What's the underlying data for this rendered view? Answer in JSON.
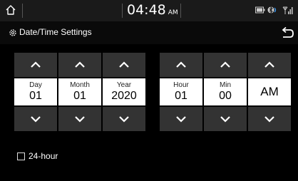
{
  "statusbar": {
    "time": "04:48",
    "ampm": "AM"
  },
  "header": {
    "title": "Date/Time Settings"
  },
  "date": {
    "day": {
      "label": "Day",
      "value": "01"
    },
    "month": {
      "label": "Month",
      "value": "01"
    },
    "year": {
      "label": "Year",
      "value": "2020"
    }
  },
  "time": {
    "hour": {
      "label": "Hour",
      "value": "01"
    },
    "min": {
      "label": "Min",
      "value": "00"
    },
    "ampm": {
      "value": "AM"
    }
  },
  "options": {
    "hour24_label": "24-hour",
    "hour24_checked": false
  }
}
